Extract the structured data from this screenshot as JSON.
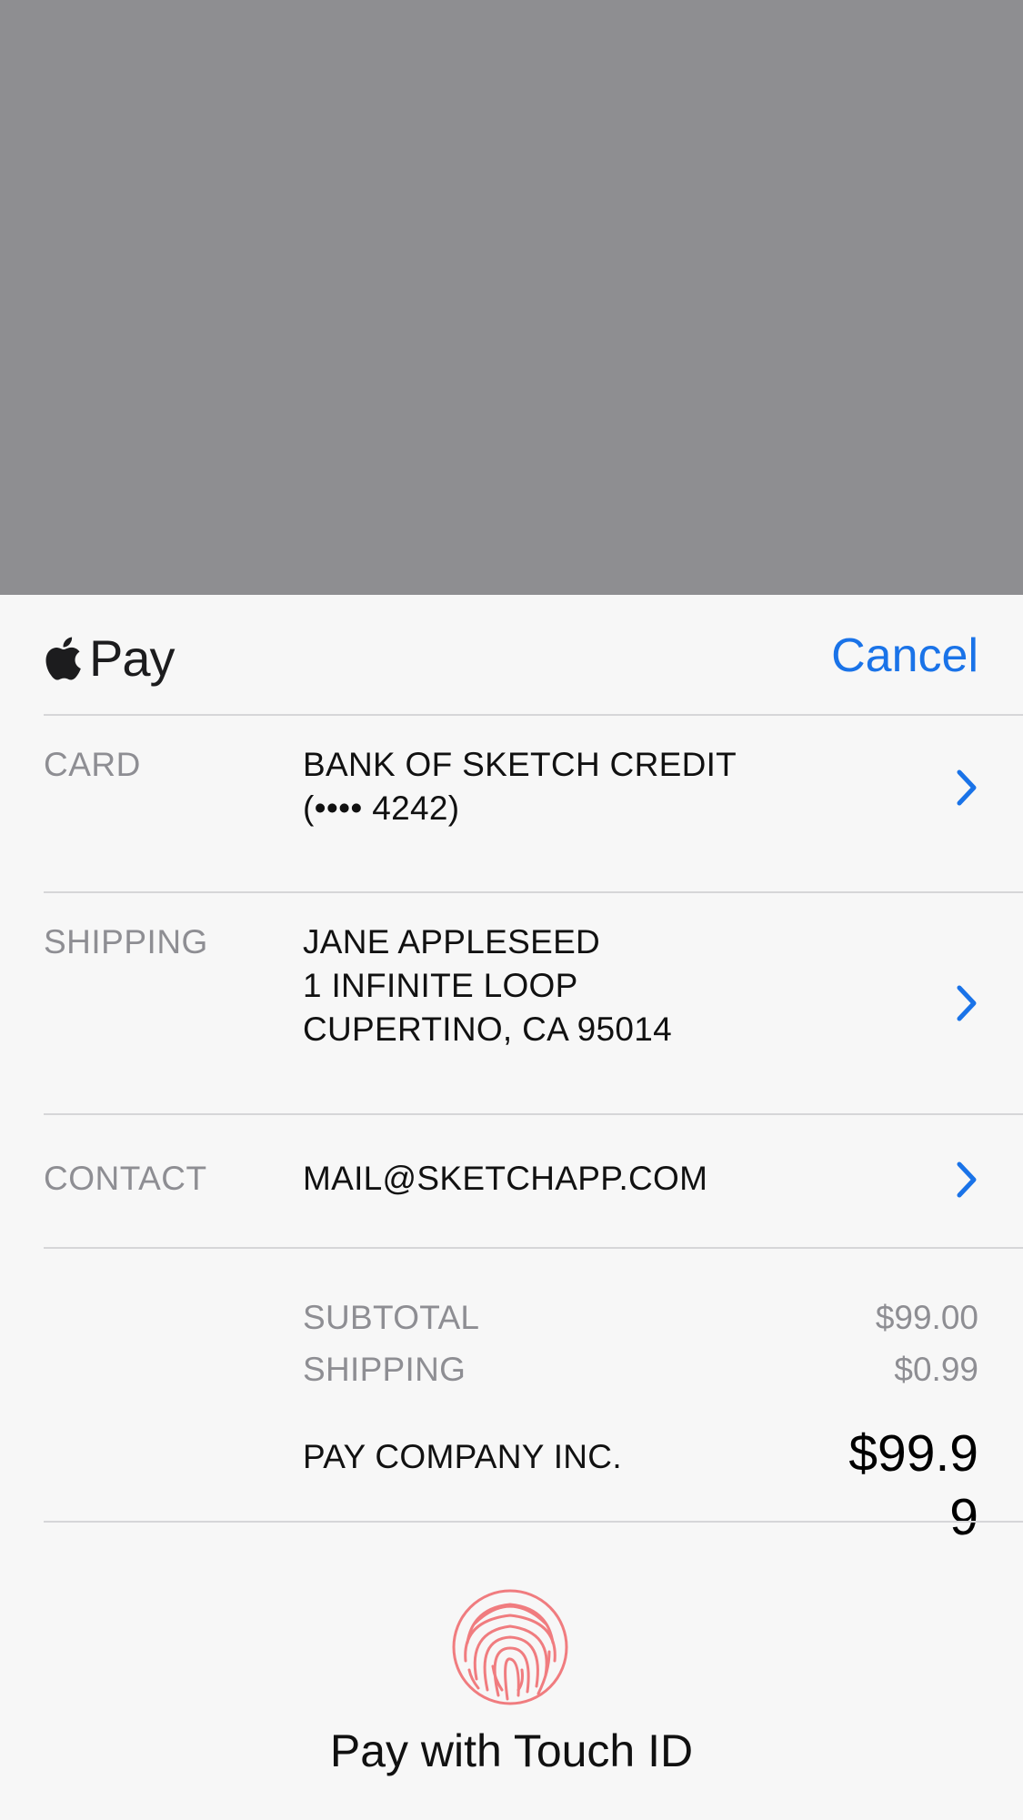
{
  "header": {
    "brand_text": "Pay",
    "cancel_label": "Cancel"
  },
  "rows": {
    "card": {
      "label": "CARD",
      "lines": [
        "BANK OF SKETCH CREDIT",
        "(•••• 4242)"
      ]
    },
    "shipping": {
      "label": "SHIPPING",
      "lines": [
        "JANE APPLESEED",
        "1 INFINITE LOOP",
        "CUPERTINO, CA 95014"
      ]
    },
    "contact": {
      "label": "CONTACT",
      "lines": [
        "MAIL@SKETCHAPP.COM"
      ]
    }
  },
  "summary": {
    "subtotal_label": "SUBTOTAL",
    "subtotal_value": "$99.00",
    "shipping_label": "SHIPPING",
    "shipping_value": "$0.99",
    "total_label": "PAY COMPANY INC.",
    "total_value": "$99.99"
  },
  "footer": {
    "touch_label": "Pay with Touch ID"
  },
  "colors": {
    "accent": "#1a73e8",
    "backdrop": "#8e8e91",
    "sheet": "#f7f7f7",
    "fingerprint": "#f07c7f",
    "secondary_text": "#8e8e93"
  },
  "icons": {
    "brand": "apple-icon",
    "disclosure": "chevron-right-icon",
    "touch_id": "fingerprint-icon"
  }
}
